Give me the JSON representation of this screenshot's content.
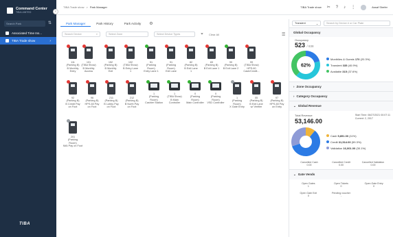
{
  "sidebar": {
    "title": "Command Center",
    "subtitle": "TIBA LIMITED",
    "search_placeholder": "Search Park",
    "items": [
      {
        "label": "Associated Time Ins..."
      },
      {
        "label": "TIBA Trade show"
      }
    ],
    "brand": "TIBA"
  },
  "topbar": {
    "crumb_1": "TIBA Trade show",
    "crumb_sep": ">",
    "crumb_2": "Park Manager",
    "site": "TIBA Trade show",
    "user": "Assaf Shefer"
  },
  "tabs": [
    {
      "label": "Park Manager"
    },
    {
      "label": "Park History"
    },
    {
      "label": "Park Activity"
    }
  ],
  "filters": {
    "search_placeholder": "Search Device",
    "zone_placeholder": "Select Zone",
    "type_placeholder": "Select Device Types",
    "clear": "Clear All"
  },
  "devices": [
    {
      "l1": "111",
      "l2": "(Parking B)",
      "l3": "B Monthly",
      "l4": "Entry",
      "status": "red",
      "kind": "tall"
    },
    {
      "l1": "101",
      "l2": "(TIBA Show)",
      "l3": "B Monthly",
      "l4": "Access",
      "status": "red",
      "kind": "tall"
    },
    {
      "l1": "152",
      "l2": "(Parking B)",
      "l3": "B Monthly",
      "l4": "Exit",
      "status": "red",
      "kind": "tall"
    },
    {
      "l1": "102",
      "l2": "(TIBA Show)",
      "l3": "B Entry Lane",
      "l4": "1",
      "status": "red",
      "kind": "tall"
    },
    {
      "l1": "51",
      "l2": "(Parking",
      "l3": "Room)",
      "l4": "Entry Lane 1",
      "status": "green",
      "kind": "tall"
    },
    {
      "l1": "91",
      "l2": "(Parking",
      "l3": "Room)",
      "l4": "Exit Lane",
      "status": "red",
      "kind": "tall"
    },
    {
      "l1": "82",
      "l2": "(Parking B)",
      "l3": "B Exit Lane",
      "l4": "1",
      "status": "red",
      "kind": "tall"
    },
    {
      "l1": "83",
      "l2": "(Parking B)",
      "l3": "B Exit Lane 1",
      "l4": "",
      "status": "red",
      "kind": "tall"
    },
    {
      "l1": "90",
      "l2": "(Parking B)",
      "l3": "B Exit Lane 2",
      "l4": "",
      "status": "green",
      "kind": "tall"
    },
    {
      "l1": "99",
      "l2": "(TIBA Show)",
      "l3": "HPS-60",
      "l4": "Cash/Credit...",
      "status": "red",
      "kind": "tall"
    },
    {
      "l1": "92",
      "l2": "(Parking B)",
      "l3": "B Credit Pay",
      "l4": "on Foot",
      "status": "red",
      "kind": "tall"
    },
    {
      "l1": "96",
      "l2": "(Parking B)",
      "l3": "HPS-60 Pay",
      "l4": "on Foot",
      "status": "red",
      "kind": "tall"
    },
    {
      "l1": "211",
      "l2": "(Parking B)",
      "l3": "B Lobby Pay",
      "l4": "on Foot",
      "status": "red",
      "kind": "tall"
    },
    {
      "l1": "212",
      "l2": "(Parking B)",
      "l3": "B North Pay",
      "l4": "on Foot",
      "status": "red",
      "kind": "tall"
    },
    {
      "l1": "1",
      "l2": "(Parking",
      "l3": "Room)",
      "l4": "Cashier Station",
      "status": "green",
      "kind": "wide"
    },
    {
      "l1": "1",
      "l2": "(TIBA Show)",
      "l3": "B Main",
      "l4": "Controller",
      "status": "green",
      "kind": "wide"
    },
    {
      "l1": "0",
      "l2": "(Parking",
      "l3": "Room)",
      "l4": "Main Controller",
      "status": "green",
      "kind": "wide"
    },
    {
      "l1": "0",
      "l2": "(Parking",
      "l3": "Room)",
      "l4": "VSD Controller",
      "status": "green",
      "kind": "wide"
    },
    {
      "l1": "1",
      "l2": "(Parking",
      "l3": "Room)",
      "l4": "X Gate Entry",
      "status": "grey",
      "kind": "tall"
    },
    {
      "l1": "05",
      "l2": "(Parking B)",
      "l3": "B Exit Lane",
      "l4": "w/ Verifier",
      "status": "red",
      "kind": "tall"
    },
    {
      "l1": "97",
      "l2": "(Parking B)",
      "l3": "HPS-60 Pay",
      "l4": "on Entry",
      "status": "red",
      "kind": "tall"
    },
    {
      "l1": "201",
      "l2": "(Parking",
      "l3": "Room)",
      "l4": "MAI Pay on Foot",
      "status": "grey",
      "kind": "tall"
    }
  ],
  "panel": {
    "select": "Transient",
    "search_placeholder": "Search by Device # or Car Plate",
    "global_occupancy": "Global Occupancy",
    "occupancy_label": "Occupancy",
    "occupancy_value": "523",
    "occupancy_total": "/ 838",
    "occupancy_pct": "62%",
    "legend": [
      {
        "label": "Monthlies & Guests",
        "value": "170",
        "pct": "(20.3%)",
        "color": "#2c7be5"
      },
      {
        "label": "Transient",
        "value": "335",
        "pct": "(40.9%)",
        "color": "#26c6da"
      },
      {
        "label": "Available",
        "value": "315",
        "pct": "(37.6%)",
        "color": "#43c463"
      }
    ],
    "zone_occupancy": "Zone Occupancy",
    "category_occupancy": "Category Occupancy",
    "global_revenue": "Global Revenue",
    "revenue_label": "Total Revenue",
    "revenue_value": "53,146.00",
    "start_time": "Start Time: 06/27/2021 00:07:11",
    "current": "Current: 2, 2017",
    "revenue_legend": [
      {
        "label": "Cash",
        "value": "5,851.00",
        "pct": "(11%)",
        "color": "#f0b43a"
      },
      {
        "label": "Credit",
        "value": "31,514.00",
        "pct": "(59.3%)",
        "color": "#2c7be5"
      },
      {
        "label": "Validation",
        "value": "16,001.00",
        "pct": "(30.1%)",
        "color": "#8e9bd6"
      }
    ],
    "cancelled": [
      {
        "label": "Cancelled Cash",
        "value": "0.00"
      },
      {
        "label": "Cancelled Credit",
        "value": "0.00"
      },
      {
        "label": "Cancelled Validation",
        "value": "0.00"
      }
    ],
    "gate_vends": "Gate Vends",
    "gates": [
      {
        "label": "Open Gates",
        "value": "1"
      },
      {
        "label": "Open Tickets",
        "value": "0"
      },
      {
        "label": "Open Gate Entry",
        "value": "0"
      },
      {
        "label": "Open Gate Exit",
        "value": "0"
      },
      {
        "label": "Pending voucher",
        "value": "-"
      }
    ]
  }
}
